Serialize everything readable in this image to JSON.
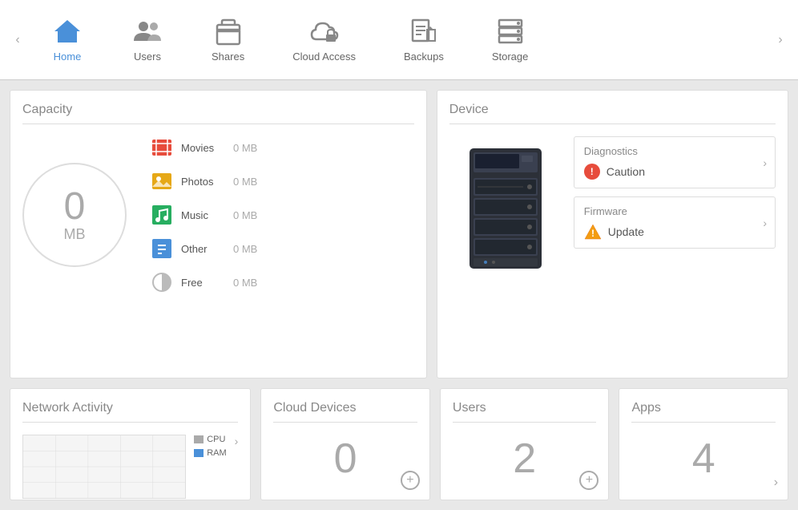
{
  "nav": {
    "items": [
      {
        "id": "home",
        "label": "Home",
        "active": true
      },
      {
        "id": "users",
        "label": "Users",
        "active": false
      },
      {
        "id": "shares",
        "label": "Shares",
        "active": false
      },
      {
        "id": "cloud-access",
        "label": "Cloud Access",
        "active": false
      },
      {
        "id": "backups",
        "label": "Backups",
        "active": false
      },
      {
        "id": "storage",
        "label": "Storage",
        "active": false
      }
    ]
  },
  "capacity": {
    "title": "Capacity",
    "value": "0",
    "unit": "MB",
    "legend": [
      {
        "name": "Movies",
        "value": "0 MB",
        "color": "#e74c3c"
      },
      {
        "name": "Photos",
        "value": "0 MB",
        "color": "#e6a817"
      },
      {
        "name": "Music",
        "value": "0 MB",
        "color": "#27ae60"
      },
      {
        "name": "Other",
        "value": "0 MB",
        "color": "#4a90d9"
      },
      {
        "name": "Free",
        "value": "0 MB",
        "color": "#bbb"
      }
    ]
  },
  "device": {
    "title": "Device",
    "diagnostics": {
      "title": "Diagnostics",
      "status": "Caution",
      "type": "error"
    },
    "firmware": {
      "title": "Firmware",
      "status": "Update",
      "type": "warning"
    }
  },
  "network": {
    "title": "Network Activity",
    "cpu_label": "CPU",
    "ram_label": "RAM"
  },
  "cloud_devices": {
    "title": "Cloud Devices",
    "count": "0"
  },
  "users": {
    "title": "Users",
    "count": "2"
  },
  "apps": {
    "title": "Apps",
    "count": "4"
  }
}
